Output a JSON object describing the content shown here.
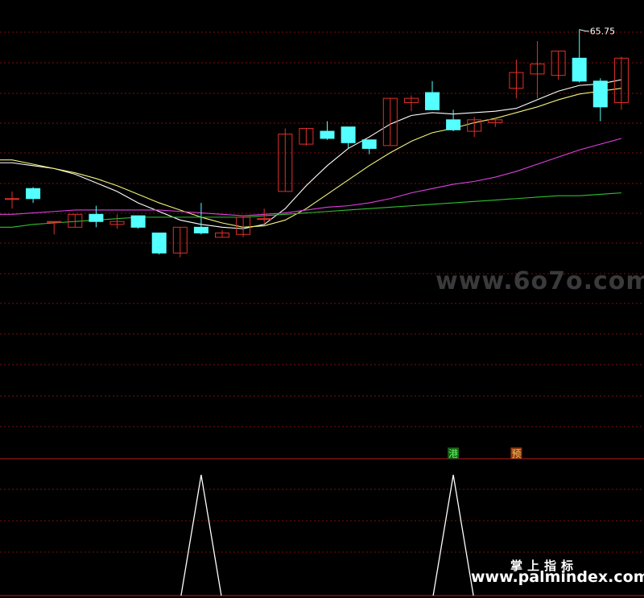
{
  "chart_data": {
    "type": "candlestick",
    "price_range": [
      54.0,
      66.5
    ],
    "high_label": "65.75",
    "candles": [
      {
        "o": 59.85,
        "h": 60.1,
        "l": 59.5,
        "c": 59.85
      },
      {
        "o": 60.2,
        "h": 60.25,
        "l": 59.7,
        "c": 59.85
      },
      {
        "o": 59.05,
        "h": 59.05,
        "l": 58.6,
        "c": 59.05
      },
      {
        "o": 58.85,
        "h": 59.3,
        "l": 58.85,
        "c": 59.3
      },
      {
        "o": 59.3,
        "h": 59.6,
        "l": 58.85,
        "c": 59.05
      },
      {
        "o": 58.95,
        "h": 59.3,
        "l": 58.8,
        "c": 59.05
      },
      {
        "o": 59.25,
        "h": 59.25,
        "l": 58.8,
        "c": 58.85
      },
      {
        "o": 58.65,
        "h": 58.65,
        "l": 57.9,
        "c": 57.95
      },
      {
        "o": 57.95,
        "h": 58.85,
        "l": 57.8,
        "c": 58.85
      },
      {
        "o": 58.85,
        "h": 59.7,
        "l": 58.6,
        "c": 58.65
      },
      {
        "o": 58.5,
        "h": 58.75,
        "l": 58.5,
        "c": 58.65
      },
      {
        "o": 58.6,
        "h": 59.2,
        "l": 58.5,
        "c": 59.2
      },
      {
        "o": 59.15,
        "h": 59.5,
        "l": 59.0,
        "c": 59.15
      },
      {
        "o": 60.1,
        "h": 62.3,
        "l": 60.1,
        "c": 62.1
      },
      {
        "o": 61.75,
        "h": 62.3,
        "l": 61.7,
        "c": 62.3
      },
      {
        "o": 62.2,
        "h": 62.55,
        "l": 61.9,
        "c": 61.95
      },
      {
        "o": 62.35,
        "h": 62.35,
        "l": 61.6,
        "c": 61.8
      },
      {
        "o": 61.9,
        "h": 61.9,
        "l": 61.4,
        "c": 61.6
      },
      {
        "o": 61.7,
        "h": 63.35,
        "l": 61.7,
        "c": 63.35
      },
      {
        "o": 63.2,
        "h": 63.45,
        "l": 62.9,
        "c": 63.35
      },
      {
        "o": 63.55,
        "h": 63.95,
        "l": 62.95,
        "c": 62.95
      },
      {
        "o": 62.6,
        "h": 62.95,
        "l": 62.2,
        "c": 62.25
      },
      {
        "o": 62.2,
        "h": 62.7,
        "l": 62.0,
        "c": 62.6
      },
      {
        "o": 62.5,
        "h": 62.65,
        "l": 62.35,
        "c": 62.6
      },
      {
        "o": 63.7,
        "h": 64.7,
        "l": 63.35,
        "c": 64.25
      },
      {
        "o": 64.2,
        "h": 65.35,
        "l": 63.35,
        "c": 64.55
      },
      {
        "o": 64.15,
        "h": 65.0,
        "l": 64.0,
        "c": 65.0
      },
      {
        "o": 64.75,
        "h": 65.75,
        "l": 63.9,
        "c": 63.95
      },
      {
        "o": 63.95,
        "h": 64.05,
        "l": 62.55,
        "c": 63.05
      },
      {
        "o": 63.2,
        "h": 64.8,
        "l": 62.95,
        "c": 64.75
      }
    ],
    "ma_series": [
      {
        "color": "#ffffff",
        "values": [
          61.1,
          61.0,
          60.9,
          60.7,
          60.4,
          60.1,
          59.7,
          59.4,
          59.1,
          58.95,
          58.85,
          58.8,
          58.95,
          59.5,
          60.3,
          61.0,
          61.6,
          62.0,
          62.45,
          62.75,
          62.85,
          62.8,
          62.85,
          62.9,
          63.0,
          63.3,
          63.6,
          63.8,
          63.85,
          64.0
        ]
      },
      {
        "color": "#f4f47a",
        "values": [
          61.2,
          61.05,
          60.9,
          60.75,
          60.55,
          60.3,
          60.0,
          59.7,
          59.45,
          59.2,
          59.0,
          58.85,
          58.9,
          59.1,
          59.5,
          60.0,
          60.5,
          61.0,
          61.45,
          61.85,
          62.15,
          62.3,
          62.5,
          62.65,
          62.85,
          63.05,
          63.3,
          63.5,
          63.6,
          63.7
        ]
      },
      {
        "color": "#e040e0",
        "values": [
          59.3,
          59.35,
          59.4,
          59.45,
          59.45,
          59.45,
          59.45,
          59.45,
          59.4,
          59.35,
          59.3,
          59.25,
          59.3,
          59.35,
          59.45,
          59.55,
          59.6,
          59.7,
          59.85,
          60.05,
          60.2,
          60.35,
          60.45,
          60.6,
          60.8,
          61.05,
          61.3,
          61.55,
          61.75,
          61.95
        ]
      },
      {
        "color": "#30c030",
        "values": [
          58.85,
          58.95,
          59.0,
          59.05,
          59.1,
          59.15,
          59.2,
          59.2,
          59.2,
          59.2,
          59.2,
          59.2,
          59.25,
          59.3,
          59.35,
          59.4,
          59.45,
          59.5,
          59.55,
          59.6,
          59.65,
          59.7,
          59.75,
          59.8,
          59.85,
          59.9,
          59.95,
          59.95,
          60.0,
          60.05
        ]
      }
    ],
    "signal_values": [
      0,
      0,
      0,
      0,
      0,
      0,
      0,
      0,
      0,
      1,
      0,
      0,
      0,
      0,
      0,
      0,
      0,
      0,
      0,
      0,
      0,
      1,
      0,
      0,
      0,
      0,
      0,
      0,
      0,
      0
    ],
    "markers": [
      {
        "text": "港",
        "index": 21,
        "bg": "#1a5a1a",
        "fg": "#5aff5a"
      },
      {
        "text": "预",
        "index": 24,
        "bg": "#8a3a10",
        "fg": "#ffc060"
      }
    ],
    "colors": {
      "up": "#e0302a",
      "down": "#54ffff",
      "grid": "#7a1010",
      "divider": "#c01818",
      "signal": "#ffffff"
    }
  },
  "watermarks": {
    "site1": "www.6o7o.com",
    "brand_cn": "掌上指标",
    "site2": "www.palmindex.com"
  }
}
